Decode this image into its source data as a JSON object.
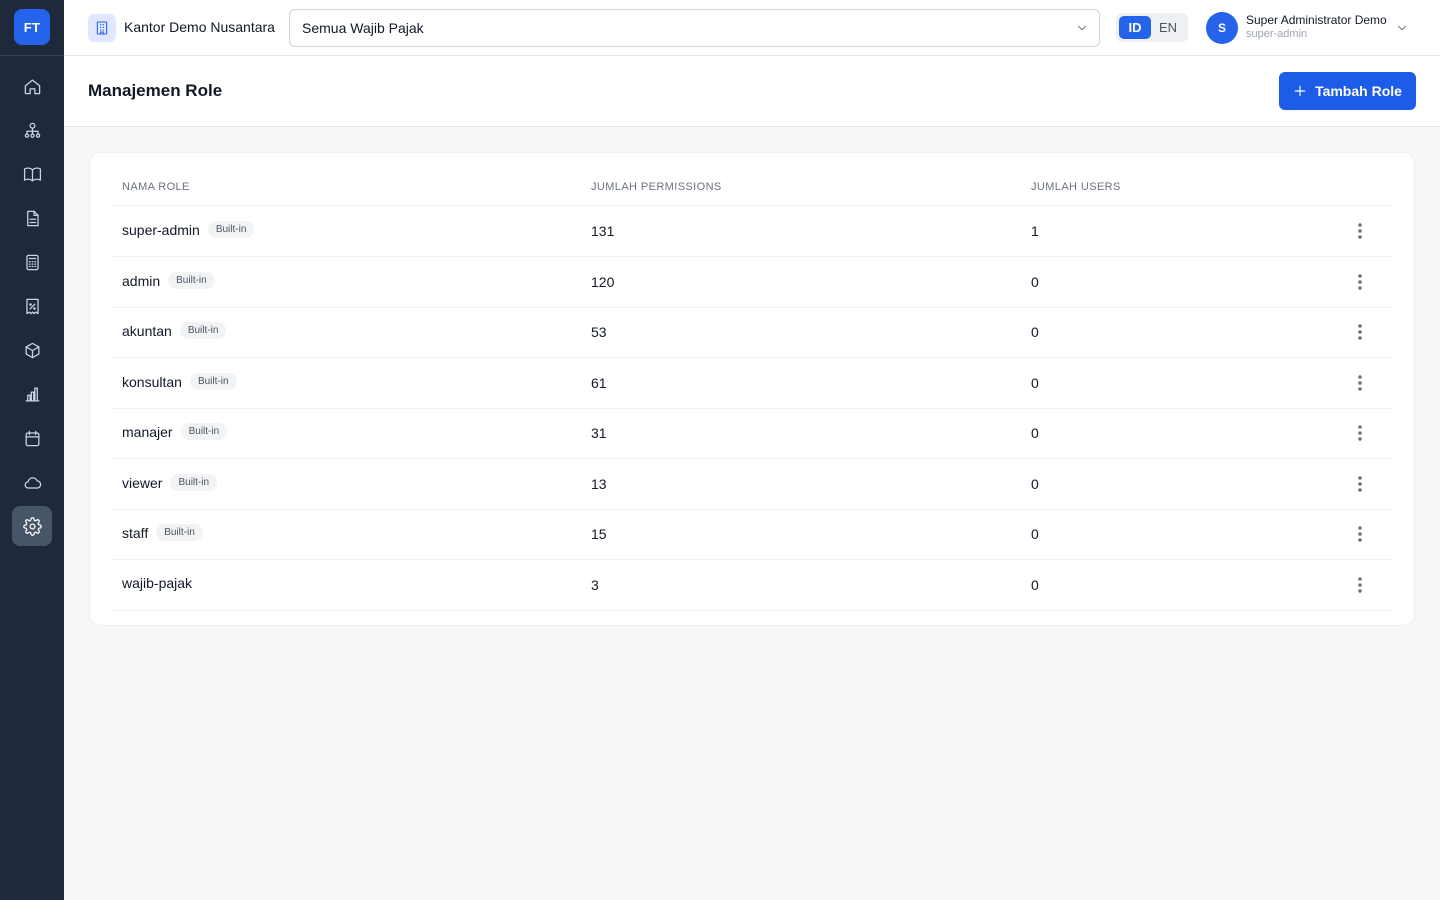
{
  "app": {
    "logo_text": "FT"
  },
  "sidebar": {
    "items": [
      {
        "icon": "home-icon",
        "active": false
      },
      {
        "icon": "users-icon",
        "active": false
      },
      {
        "icon": "book-icon",
        "active": false
      },
      {
        "icon": "document-icon",
        "active": false
      },
      {
        "icon": "calculator-icon",
        "active": false
      },
      {
        "icon": "receipt-icon",
        "active": false
      },
      {
        "icon": "box-icon",
        "active": false
      },
      {
        "icon": "bar-chart-icon",
        "active": false
      },
      {
        "icon": "calendar-icon",
        "active": false
      },
      {
        "icon": "cloud-icon",
        "active": false
      },
      {
        "icon": "gear-icon",
        "active": true
      }
    ]
  },
  "header": {
    "office_name": "Kantor Demo Nusantara",
    "taxpayer_select": "Semua Wajib Pajak",
    "lang": {
      "id": "ID",
      "en": "EN",
      "selected": "ID"
    },
    "user": {
      "initial": "S",
      "name": "Super Administrator Demo",
      "role": "super-admin"
    }
  },
  "page": {
    "title": "Manajemen Role",
    "add_button": "Tambah Role"
  },
  "table": {
    "columns": [
      "NAMA ROLE",
      "JUMLAH PERMISSIONS",
      "JUMLAH USERS"
    ],
    "rows": [
      {
        "name": "super-admin",
        "badge": "Built-in",
        "permissions": "131",
        "users": "1"
      },
      {
        "name": "admin",
        "badge": "Built-in",
        "permissions": "120",
        "users": "0"
      },
      {
        "name": "akuntan",
        "badge": "Built-in",
        "permissions": "53",
        "users": "0"
      },
      {
        "name": "konsultan",
        "badge": "Built-in",
        "permissions": "61",
        "users": "0"
      },
      {
        "name": "manajer",
        "badge": "Built-in",
        "permissions": "31",
        "users": "0"
      },
      {
        "name": "viewer",
        "badge": "Built-in",
        "permissions": "13",
        "users": "0"
      },
      {
        "name": "staff",
        "badge": "Built-in",
        "permissions": "15",
        "users": "0"
      },
      {
        "name": "wajib-pajak",
        "badge": "",
        "permissions": "3",
        "users": "0"
      }
    ]
  },
  "colors": {
    "accent": "#2563eb",
    "sidebar_bg": "#1e293b"
  }
}
